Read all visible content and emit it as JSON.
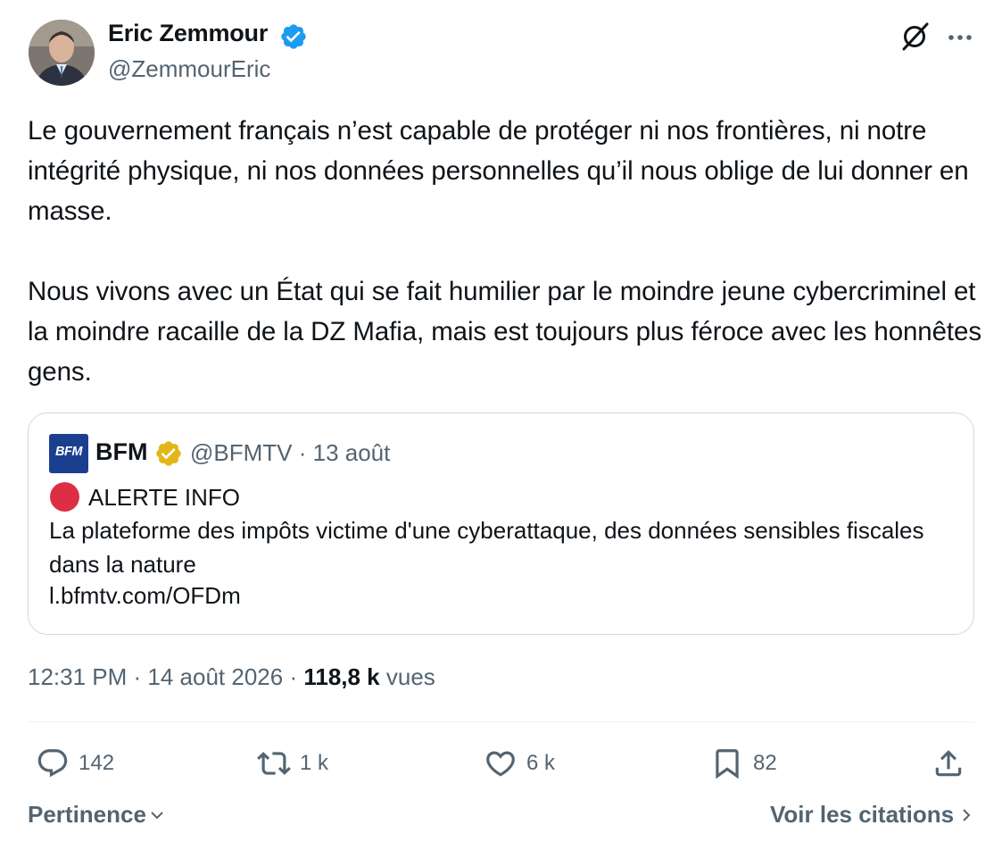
{
  "author": {
    "name": "Eric Zemmour",
    "handle": "@ZemmourEric"
  },
  "tweet": {
    "text": "Le gouvernement français n’est capable de protéger ni nos frontières, ni notre intégrité physique, ni nos données personnelles qu’il nous oblige de lui donner en masse.\n\nNous vivons avec un État qui se fait humilier par le moindre jeune cybercriminel et la moindre racaille de la DZ Mafia, mais est toujours plus féroce avec les honnêtes gens."
  },
  "quote": {
    "logo_text": "BFM",
    "name": "BFM",
    "meta": "@BFMTV · 13 août",
    "alert": "ALERTE INFO",
    "text": "La plateforme des impôts victime d'une cyberattaque, des données sensibles fiscales dans la nature",
    "link": "l.bfmtv.com/OFDm"
  },
  "meta": {
    "time": "12:31 PM",
    "sep1": " · ",
    "date": "14 août 2026",
    "sep2": " · ",
    "views_count": "118,8 k",
    "views_label": " vues"
  },
  "actions": {
    "replies": "142",
    "retweets": "1 k",
    "likes": "6 k",
    "bookmarks": "82"
  },
  "footer": {
    "sort_label": "Pertinence",
    "quotes_label": "Voir les citations"
  },
  "colors": {
    "text": "#0f1419",
    "secondary": "#536471",
    "blue_verified": "#1d9bf0",
    "gold_verified": "#e2b719",
    "alert_red": "#dd2e44",
    "bfm_blue": "#1b3f8f",
    "border": "#cfd9de"
  },
  "icons": [
    "verified-badge-icon",
    "grok-icon",
    "more-icon",
    "reply-icon",
    "retweet-icon",
    "like-icon",
    "bookmark-icon",
    "share-icon",
    "chevron-down-icon",
    "chevron-right-icon"
  ]
}
